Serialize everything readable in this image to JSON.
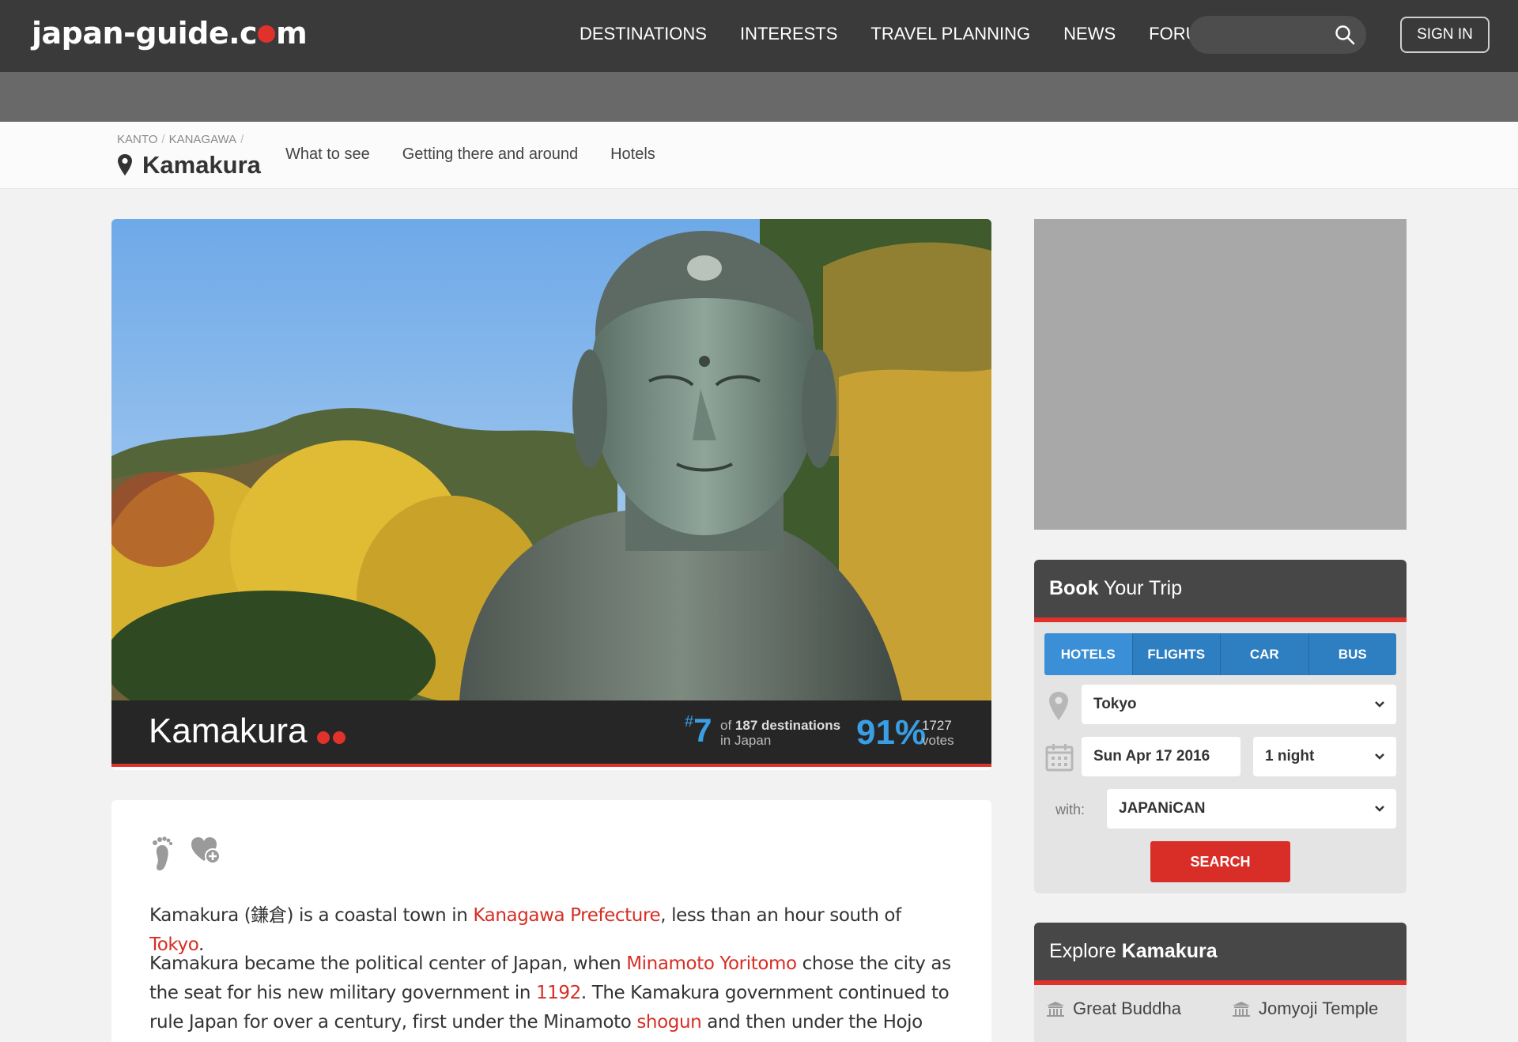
{
  "header": {
    "logo": "japan-guide.com",
    "logo_parts": [
      "japan-guide.c",
      "m"
    ],
    "nav": [
      "DESTINATIONS",
      "INTERESTS",
      "TRAVEL PLANNING",
      "NEWS",
      "FORUM"
    ],
    "search_placeholder": "",
    "signin": "SIGN IN"
  },
  "subnav": {
    "breadcrumb": [
      "KANTO",
      "KANAGAWA"
    ],
    "breadcrumb_sep": "/",
    "title": "Kamakura",
    "links": [
      "What to see",
      "Getting there and around",
      "Hotels"
    ]
  },
  "hero": {
    "name": "Kamakura",
    "rank_prefix": "#",
    "rank": "7",
    "rank_of": "of",
    "rank_total": "187 destinations",
    "rank_where": "in Japan",
    "percent": "91%",
    "votes": "1727",
    "votes_label": "votes"
  },
  "article": {
    "p1": [
      {
        "t": "Kamakura (鎌倉) is a coastal town in "
      },
      {
        "t": "Kanagawa Prefecture",
        "link": true
      },
      {
        "t": ", less than an hour south of "
      },
      {
        "t": "Tokyo",
        "link": true
      },
      {
        "t": "."
      }
    ],
    "p2": [
      {
        "t": "Kamakura became the political center of Japan, when "
      },
      {
        "t": "Minamoto Yoritomo",
        "link": true
      },
      {
        "t": " chose the city as the seat for his new military government in "
      },
      {
        "t": "1192",
        "link": true
      },
      {
        "t": ". The Kamakura government continued to rule Japan for over a century, first under the Minamoto "
      },
      {
        "t": "shogun",
        "link": true
      },
      {
        "t": " and then under the Hojo regents."
      }
    ]
  },
  "book": {
    "title_bold": "Book",
    "title_rest": " Your Trip",
    "tabs": [
      "HOTELS",
      "FLIGHTS",
      "CAR",
      "BUS"
    ],
    "location": "Tokyo",
    "date": "Sun Apr 17 2016",
    "nights": "1 night",
    "with_label": "with:",
    "provider": "JAPANiCAN",
    "search": "SEARCH"
  },
  "explore": {
    "title_rest": "Explore ",
    "title_bold": "Kamakura",
    "items": [
      "Great Buddha",
      "Jomyoji Temple"
    ]
  },
  "colors": {
    "accent_red": "#e0322b",
    "link_red": "#d62e24",
    "rank_blue": "#3a9ee4",
    "tab_blue": "#2e7fc2",
    "topbar": "#3a3a3a"
  }
}
